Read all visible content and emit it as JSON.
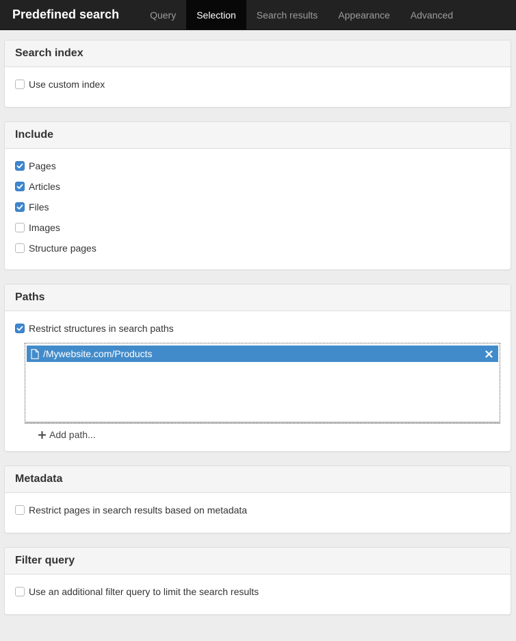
{
  "navbar": {
    "brand": "Predefined search",
    "tabs": [
      {
        "label": "Query",
        "active": false
      },
      {
        "label": "Selection",
        "active": true
      },
      {
        "label": "Search results",
        "active": false
      },
      {
        "label": "Appearance",
        "active": false
      },
      {
        "label": "Advanced",
        "active": false
      }
    ]
  },
  "search_index": {
    "title": "Search index",
    "custom_index": {
      "label": "Use custom index",
      "checked": false
    }
  },
  "include": {
    "title": "Include",
    "options": [
      {
        "label": "Pages",
        "checked": true
      },
      {
        "label": "Articles",
        "checked": true
      },
      {
        "label": "Files",
        "checked": true
      },
      {
        "label": "Images",
        "checked": false
      },
      {
        "label": "Structure pages",
        "checked": false
      }
    ]
  },
  "paths": {
    "title": "Paths",
    "restrict": {
      "label": "Restrict structures in search paths",
      "checked": true
    },
    "items": [
      {
        "path": "/Mywebsite.com/Products",
        "icon": "file-icon"
      }
    ],
    "add_label": "Add path..."
  },
  "metadata": {
    "title": "Metadata",
    "restrict": {
      "label": "Restrict pages in search results based on metadata",
      "checked": false
    }
  },
  "filter_query": {
    "title": "Filter query",
    "use_filter": {
      "label": "Use an additional filter query to limit the search results",
      "checked": false
    }
  },
  "colors": {
    "navbar_bg": "#222222",
    "active_tab_bg": "#080808",
    "accent": "#428bca",
    "checkbox_checked": "#3f86cf"
  }
}
